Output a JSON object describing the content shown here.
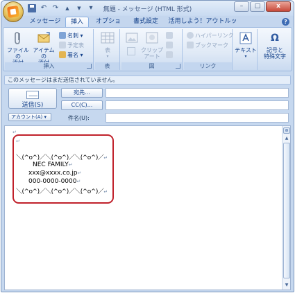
{
  "window": {
    "title": "無題 - メッセージ (HTML 形式)",
    "buttons": {
      "minimize": "–",
      "maximize": "□",
      "close": "x"
    }
  },
  "qat": {
    "undo": "↶",
    "redo": "↷",
    "up": "▲",
    "down": "▼",
    "more": "▾"
  },
  "tabs": [
    {
      "label": "メッセージ"
    },
    {
      "label": "挿入"
    },
    {
      "label": "オプション"
    },
    {
      "label": "書式設定"
    },
    {
      "label": "活用しよう！アウトルック"
    }
  ],
  "help": "?",
  "ribbon": {
    "insert_group": {
      "label": "挿入",
      "attach_file": "ファイルの\n添付",
      "attach_item": "アイテムの\n添付",
      "business_card": "名刺",
      "calendar": "予定表",
      "signature": "署名"
    },
    "table_group": {
      "label": "表",
      "table": "表"
    },
    "illustrations_group": {
      "label": "図",
      "clipart": "クリップ\nアート"
    },
    "links_group": {
      "label": "リンク",
      "hyperlink": "ハイパーリンク",
      "bookmark": "ブックマーク"
    },
    "text_group": {
      "text": "テキスト"
    },
    "symbols_group": {
      "symbols": "記号と\n特殊文字"
    }
  },
  "infobar": "このメッセージはまだ送信されていません。",
  "header": {
    "send": "送信(S)",
    "to": "宛先...",
    "cc": "CC(C)...",
    "account": "アカウント(A) ▾",
    "subject": "件名(U):",
    "to_value": "",
    "cc_value": "",
    "subject_value": ""
  },
  "body": {
    "lines": [
      "",
      "＼(^o^)／＼(^o^)／＼(^o^)／",
      "NEC FAMILY",
      "xxx@xxxx.co.jp",
      "000-0000-0000",
      "＼(^o^)／＼(^o^)／＼(^o^)／"
    ],
    "paragraph_mark": "↵"
  },
  "scrollbar": {
    "up": "▲",
    "down": "▼",
    "toggle": "⊜"
  },
  "colors": {
    "highlight_outline": "#c0202a",
    "accent": "#15428b"
  }
}
